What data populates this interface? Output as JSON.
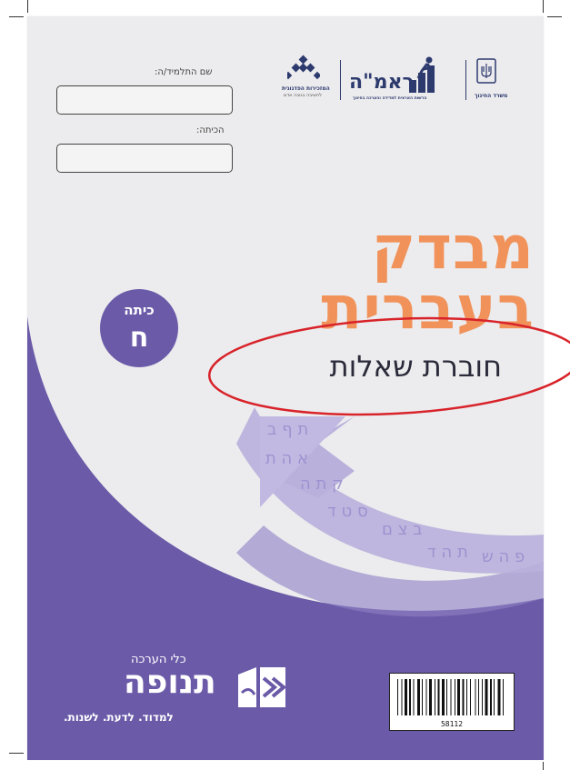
{
  "form": {
    "student_label": "שם התלמיד/ה:",
    "class_label": "הכיתה:"
  },
  "logos": {
    "ministry": "משרד החינוך",
    "rama": "ראמ\"ה",
    "rama_sub": "הרשות הארצית למדידה והערכה בחינוך",
    "center": "המזכירות הפדגוגית",
    "center_sub": "לחשיבה בגובה אדם"
  },
  "title": {
    "line1": "מבדק",
    "line2": "בעברית",
    "subtitle": "חוברת שאלות"
  },
  "grade": {
    "label": "כיתה",
    "value": "ח"
  },
  "brand": {
    "kli": "כלי הערכה",
    "name": "תנופה",
    "slogan": "למדוד. לדעת. לשנות."
  },
  "barcode": {
    "number": "58112"
  },
  "colors": {
    "purple": "#6b5aa8",
    "orange": "#f0925a",
    "annotation_red": "#d8232a"
  }
}
